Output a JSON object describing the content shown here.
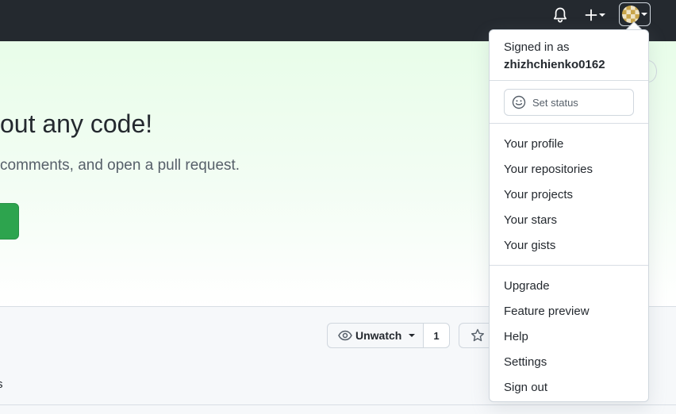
{
  "hero": {
    "title": "out any code!",
    "subtitle": "comments, and open a pull request."
  },
  "repo_actions": {
    "watch_label": "Unwatch",
    "watch_count": "1",
    "tab_fragment": "s"
  },
  "user_menu": {
    "signed_in_label": "Signed in as",
    "username": "zhizhchienko0162",
    "set_status": "Set status",
    "group1": [
      "Your profile",
      "Your repositories",
      "Your projects",
      "Your stars",
      "Your gists"
    ],
    "group2": [
      "Upgrade",
      "Feature preview",
      "Help",
      "Settings",
      "Sign out"
    ]
  },
  "colors": {
    "topbar": "#24292f",
    "primary_button": "#2da44e",
    "hero_gradient_top": "#e8fde9"
  }
}
